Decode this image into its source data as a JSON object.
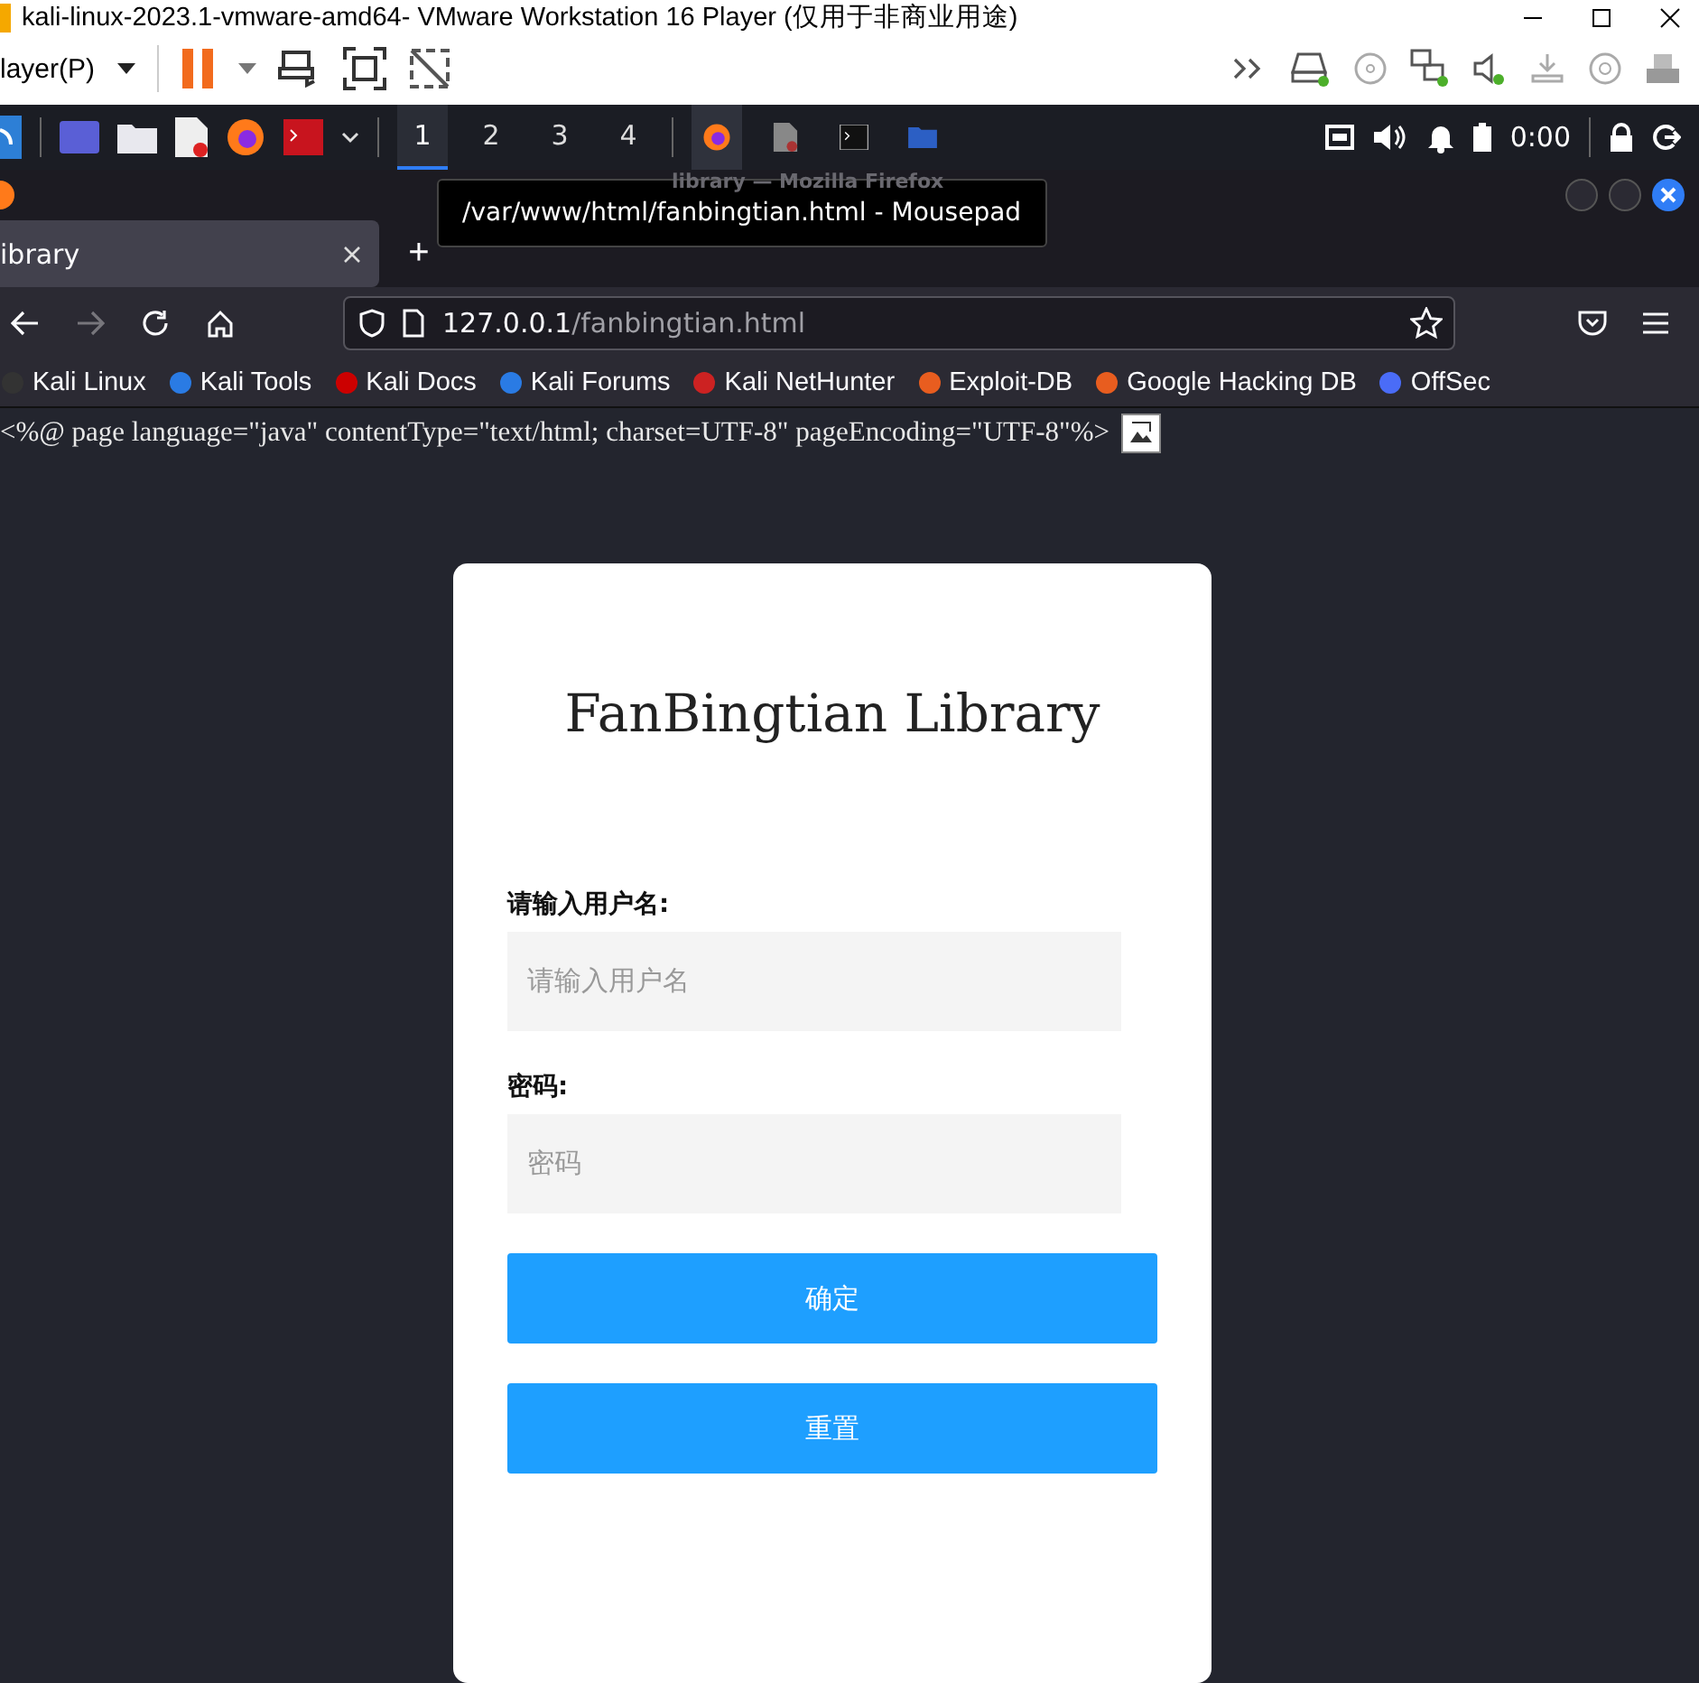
{
  "vmware": {
    "title": "kali-linux-2023.1-vmware-amd64- VMware Workstation 16 Player (仅用于非商业用途)",
    "menu": "layer(P)"
  },
  "taskbar": {
    "workspaces": [
      {
        "label": "1",
        "selected": true
      },
      {
        "label": "2",
        "selected": false
      },
      {
        "label": "3",
        "selected": false
      },
      {
        "label": "4",
        "selected": false
      }
    ],
    "clock": "0:00"
  },
  "firefox": {
    "window_title": "library — Mozilla Firefox",
    "tooltip": "/var/www/html/fanbingtian.html - Mousepad",
    "tabs": [
      {
        "label": "ibrary",
        "selected": true
      }
    ],
    "new_tab": "+",
    "forward_disabled": true,
    "url_host": "127.0.0.1",
    "url_path": "/fanbingtian.html",
    "bookmarks": [
      "Kali Linux",
      "Kali Tools",
      "Kali Docs",
      "Kali Forums",
      "Kali NetHunter",
      "Exploit-DB",
      "Google Hacking DB",
      "OffSec"
    ]
  },
  "page": {
    "source_line": "<%@ page language=\"java\" contentType=\"text/html; charset=UTF-8\" pageEncoding=\"UTF-8\"%>",
    "title": "FanBingtian Library",
    "fields": [
      {
        "label": "请输入用户名:",
        "placeholder": "请输入用户名"
      },
      {
        "label": "密码:",
        "placeholder": "密码"
      }
    ],
    "buttons": [
      "确定",
      "重置"
    ]
  }
}
